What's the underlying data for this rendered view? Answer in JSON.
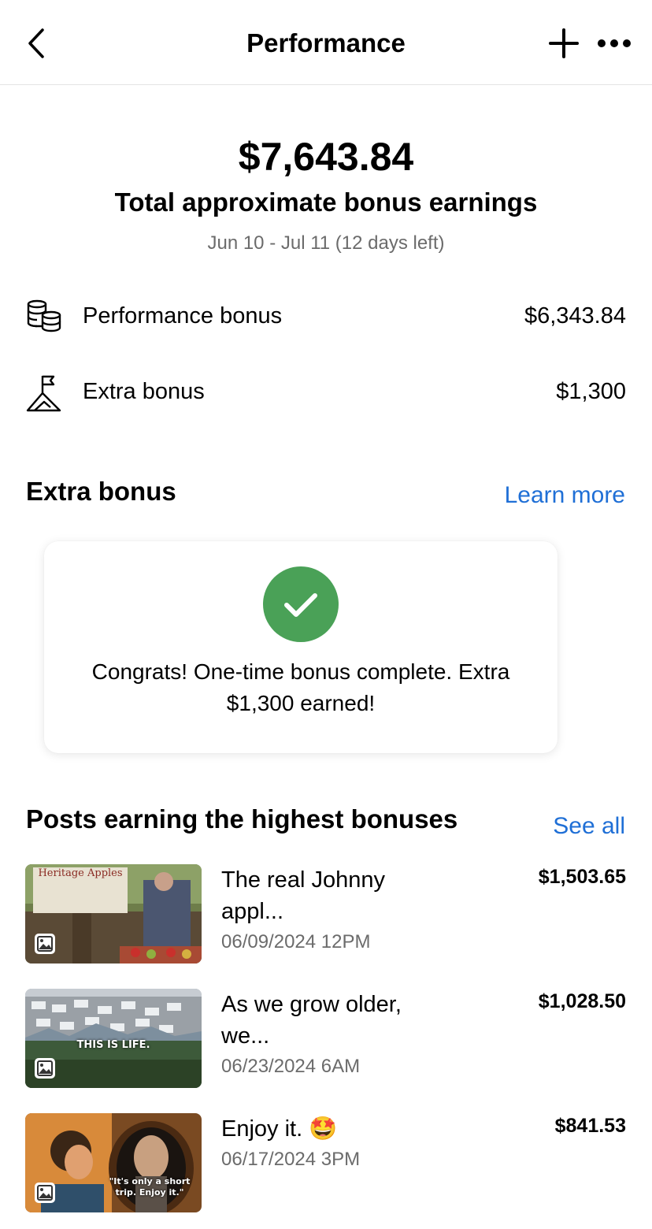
{
  "header": {
    "title": "Performance",
    "back_icon": "chevron-left-icon",
    "add_icon": "plus-icon",
    "more_icon": "more-horizontal-icon"
  },
  "summary": {
    "total": "$7,643.84",
    "total_label": "Total approximate bonus earnings",
    "date_range": "Jun 10 - Jul 11 (12 days left)"
  },
  "breakdown": [
    {
      "icon": "coins-stack-icon",
      "label": "Performance bonus",
      "value": "$6,343.84"
    },
    {
      "icon": "mountain-flag-icon",
      "label": "Extra bonus",
      "value": "$1,300"
    }
  ],
  "extra_bonus": {
    "title": "Extra bonus",
    "link": "Learn more",
    "check_color": "#4aa157",
    "message": "Congrats! One-time bonus complete. Extra $1,300 earned!"
  },
  "posts": {
    "title": "Posts earning the highest bonuses",
    "link": "See all",
    "items": [
      {
        "title": "The real Johnny appl...",
        "date": "06/09/2024 12PM",
        "amount": "$1,503.65",
        "thumb_sign": "Heritage Apples"
      },
      {
        "title": "As we grow older, we...",
        "date": "06/23/2024 6AM",
        "amount": "$1,028.50",
        "thumb_caption": "THIS IS LIFE."
      },
      {
        "title": "Enjoy it. 🤩",
        "date": "06/17/2024 3PM",
        "amount": "$841.53",
        "thumb_caption": "\"It's only a short trip. Enjoy it.\""
      }
    ]
  },
  "colors": {
    "link": "#1f6fd6",
    "muted": "#6b6b6b",
    "success": "#4aa157"
  }
}
